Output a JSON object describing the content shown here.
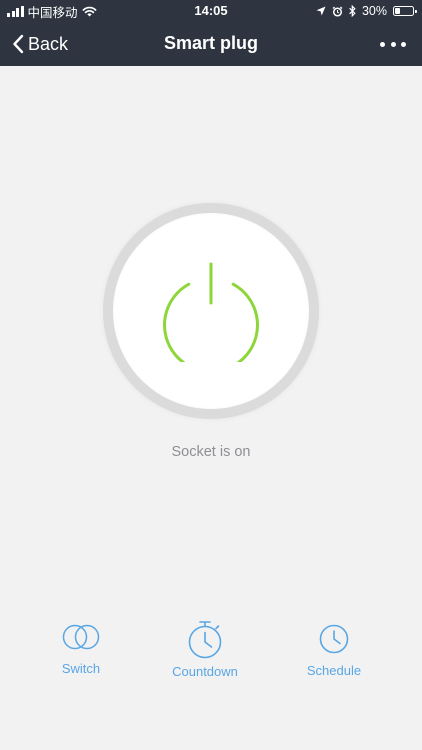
{
  "status_bar": {
    "carrier": "中国移动",
    "time": "14:05",
    "battery_percent_label": "30%",
    "battery_level": 0.3
  },
  "nav": {
    "back_label": "Back",
    "title": "Smart plug"
  },
  "power": {
    "status_text": "Socket is on",
    "state": "on",
    "on_color": "#8cd63a"
  },
  "actions": {
    "switch_label": "Switch",
    "countdown_label": "Countdown",
    "schedule_label": "Schedule"
  },
  "colors": {
    "header_bg": "#2e3440",
    "accent_blue": "#58a6e4",
    "page_bg": "#f3f2f3"
  }
}
